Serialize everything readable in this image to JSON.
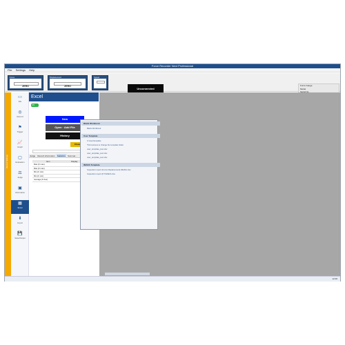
{
  "window": {
    "title": "Force Recorder Next Professional"
  },
  "menu": [
    "File",
    "Settings",
    "Help"
  ],
  "panels": [
    {
      "id": "force",
      "label": "Force",
      "value": "ZERO"
    },
    {
      "id": "displacement",
      "label": "Displacement",
      "value": "ZERO"
    },
    {
      "id": "speed",
      "label": "Speed",
      "value": ""
    }
  ],
  "status": {
    "connection": "Unconnected",
    "trigger_label": "Trigger",
    "toggle": "OFF"
  },
  "right_info": {
    "title": "Force Gauge",
    "lines": [
      "Model",
      "Serial No.",
      "Capacity"
    ]
  },
  "sidebar": {
    "vertical_label": "Record Settings",
    "items": [
      {
        "label": "File",
        "icon": "folder-icon"
      },
      {
        "label": "Record",
        "icon": "record-icon"
      },
      {
        "label": "Trigger",
        "icon": "flag-icon"
      },
      {
        "label": "Graph",
        "icon": "graph-icon"
      },
      {
        "label": "Evaluation",
        "icon": "evaluation-icon"
      },
      {
        "label": "Judge",
        "icon": "judge-icon"
      },
      {
        "label": "Information",
        "icon": "image-icon"
      },
      {
        "label": "Excel",
        "icon": "excel-icon"
      },
      {
        "label": "Import",
        "icon": "import-icon"
      },
      {
        "label": "Save/Output",
        "icon": "save-icon"
      }
    ]
  },
  "excel": {
    "title": "Excel",
    "switch": "ON",
    "buttons": {
      "new": "New",
      "open": "Open · Add File",
      "history": "History",
      "close": "Close"
    },
    "tabs": [
      "Judge",
      "Record information",
      "Statistics",
      "Summar..."
    ],
    "table": {
      "headers": [
        "Item",
        "Display"
      ],
      "rows": [
        "Max (F max)",
        "Max (F max)",
        "Min (F min)",
        "Min (F min)",
        "Average (F Ave)"
      ]
    }
  },
  "dropdown": {
    "sections": [
      {
        "title": "Blank Workbook",
        "items": [
          "Blank Workbook"
        ]
      },
      {
        "title": "User Template",
        "items": [
          "C:\\user\\template",
          "*First access to change the template folder",
          "user_template_test.xlsx",
          "user_template_test.xlsx",
          "user_template_test.xlsx"
        ]
      },
      {
        "title": "IMADA Template",
        "items": [
          "Inspection report (Force Displacement).IMADA.xlsx",
          "Inspection report (KT.IMADA.xlsx"
        ]
      }
    ]
  },
  "statusbar": {
    "time": "12:00"
  },
  "colors": {
    "accent": "#1e4f8c",
    "sidebar_accent": "#f5a800",
    "on_badge": "#2fb34a",
    "new_button": "#0018ff",
    "open_button": "#555555",
    "history_button": "#111111",
    "close_button": "#e6b800"
  }
}
